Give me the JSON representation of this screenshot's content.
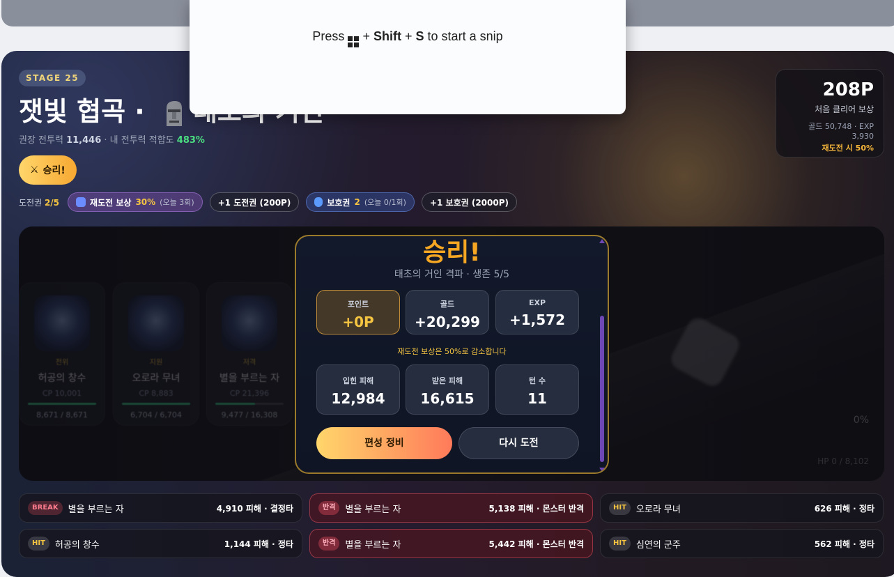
{
  "stage": {
    "badge": "STAGE 25",
    "title_prefix": "잿빛 협곡 · ",
    "title_suffix": "태초의 거인",
    "recommended_label": "권장 전투력",
    "recommended_power": "11,446",
    "fit_label": "· 내 전투력 적합도",
    "fit_value": "483%",
    "victory_label": "승리!"
  },
  "reward_card": {
    "points": "208P",
    "label": "처음 클리어 보상",
    "detail": "골드 50,748 · EXP 3,930",
    "retry_note": "재도전 시 50%"
  },
  "tickets": {
    "label": "도전권",
    "count": "2/5",
    "retry_reward_label": "재도전 보상",
    "retry_reward_pct": "30%",
    "retry_reward_today": "(오늘 3회)",
    "buy_ticket": "+1 도전권 (200P)",
    "shield_label": "보호권",
    "shield_count": "2",
    "shield_today": "(오늘 0/1회)",
    "buy_shield": "+1 보호권 (2000P)"
  },
  "allies": [
    {
      "role": "전위",
      "name": "허공의 창수",
      "cp": "CP 10,001",
      "hp": "8,671 / 8,671",
      "hp_fraction": 1.0
    },
    {
      "role": "지원",
      "name": "오로라 무녀",
      "cp": "CP 8,883",
      "hp": "6,704 / 6,704",
      "hp_fraction": 1.0
    },
    {
      "role": "저격",
      "name": "별을 부르는 자",
      "cp": "CP 21,396",
      "hp": "9,477 / 16,308",
      "hp_fraction": 0.58
    }
  ],
  "enemy": {
    "percent": "0%",
    "hp": "HP 0 / 8,102"
  },
  "result": {
    "title": "승리!",
    "subtitle": "태초의 거인 격파 · 생존 5/5",
    "rewards": [
      {
        "label": "포인트",
        "value": "+0P"
      },
      {
        "label": "골드",
        "value": "+20,299"
      },
      {
        "label": "EXP",
        "value": "+1,572"
      }
    ],
    "note": "재도전 보상은 50%로 감소합니다",
    "stats": [
      {
        "label": "입힌 피해",
        "value": "12,984"
      },
      {
        "label": "받은 피해",
        "value": "16,615"
      },
      {
        "label": "턴 수",
        "value": "11"
      }
    ],
    "primary_button": "편성 정비",
    "secondary_button": "다시 도전"
  },
  "battle_log": [
    {
      "tag": "BREAK",
      "name": "별을 부르는 자",
      "damage": "4,910 피해 · 결정타"
    },
    {
      "tag": "반격",
      "name": "별을 부르는 자",
      "damage": "5,138 피해 · 몬스터 반격"
    },
    {
      "tag": "HIT",
      "name": "오로라 무녀",
      "damage": "626 피해 · 정타"
    },
    {
      "tag": "HIT",
      "name": "허공의 창수",
      "damage": "1,144 피해 · 정타"
    },
    {
      "tag": "반격",
      "name": "별을 부르는 자",
      "damage": "5,442 피해 · 몬스터 반격"
    },
    {
      "tag": "HIT",
      "name": "심연의 군주",
      "damage": "562 피해 · 정타"
    }
  ],
  "snip": {
    "press": "Press",
    "plus1": "+",
    "shift": "Shift",
    "plus2": "+",
    "key": "S",
    "suffix": "to start a snip"
  }
}
